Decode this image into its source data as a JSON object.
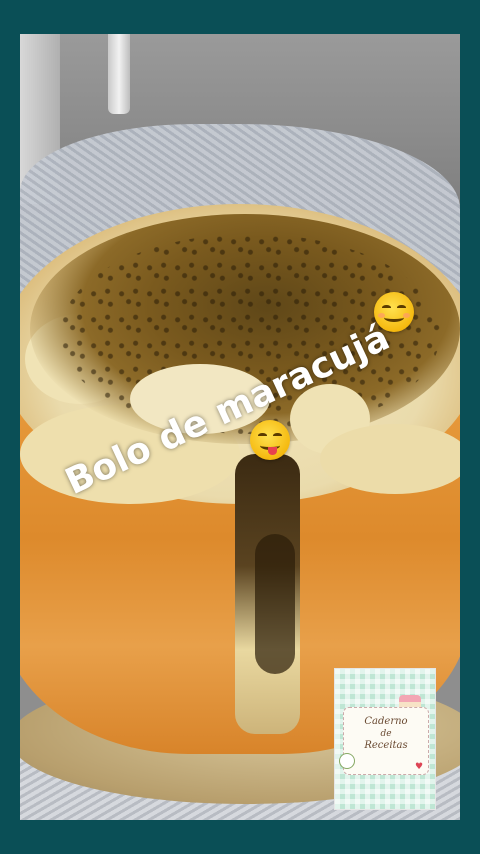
{
  "post": {
    "caption": "Bolo de maracujá",
    "emojis": [
      "smiling-face-emoji",
      "savoring-food-face-emoji"
    ]
  },
  "watermark": {
    "line1": "Caderno",
    "line2": "de",
    "line3": "Receitas"
  },
  "colors": {
    "border": "#0a4f56",
    "caption": "#ffffff",
    "cake": "#e79a3b",
    "syrup": "#7a5a1e",
    "logo_bg": "#bfe6d4"
  }
}
